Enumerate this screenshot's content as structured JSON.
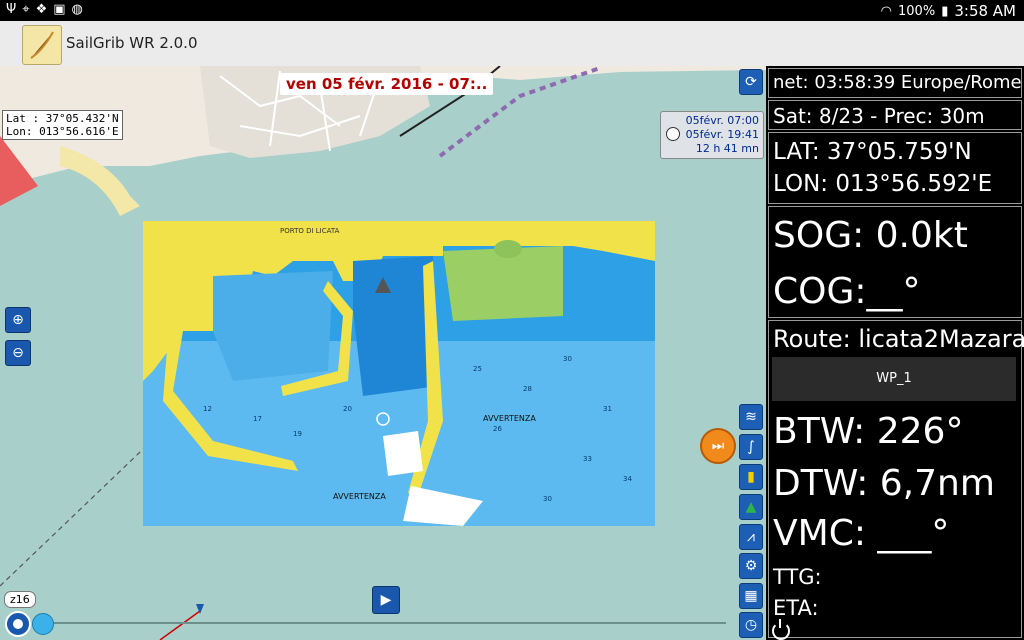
{
  "statusbar": {
    "left_icons": [
      "usb-icon",
      "location-icon",
      "dropbox-icon",
      "app-notification-icon",
      "compass-notification-icon"
    ],
    "battery": "100%",
    "time": "3:58 AM"
  },
  "app": {
    "title": "SailGrib WR 2.0.0"
  },
  "map": {
    "date_banner": "ven 05 févr. 2016 - 07:..",
    "position_lat": "Lat :  37°05.432'N",
    "position_lon": "Lon: 013°56.616'E",
    "sunrise": "05févr. 07:00",
    "sunset": "05févr. 19:41",
    "daylight": "12 h 41 mn",
    "zoom_level": "z16",
    "chart_labels": [
      "PORTO DI LICATA",
      "AVVERTENZA",
      "AVVERTENZA"
    ]
  },
  "panel": {
    "time": "net: 03:58:39 Europe/Rome",
    "sat": "Sat: 8/23 - Prec: 30m",
    "lat": "LAT: 37°05.759'N",
    "lon": "LON: 013°56.592'E",
    "sog": "SOG: 0.0kt",
    "cog": "COG:__°",
    "route": "Route: licata2Mazara",
    "waypoint": "WP_1",
    "btw": "BTW: 226°",
    "dtw": "DTW: 6,7nm",
    "vmc": "VMC: ___°",
    "ttg": "TTG:",
    "eta": "ETA:"
  },
  "toolbar_icons": [
    "grib-weather-icon",
    "route-icon",
    "cardinal-buoy-icon",
    "lateral-buoy-icon",
    "measure-compass-icon",
    "settings-gear-icon",
    "table-icon",
    "clock-icon"
  ]
}
